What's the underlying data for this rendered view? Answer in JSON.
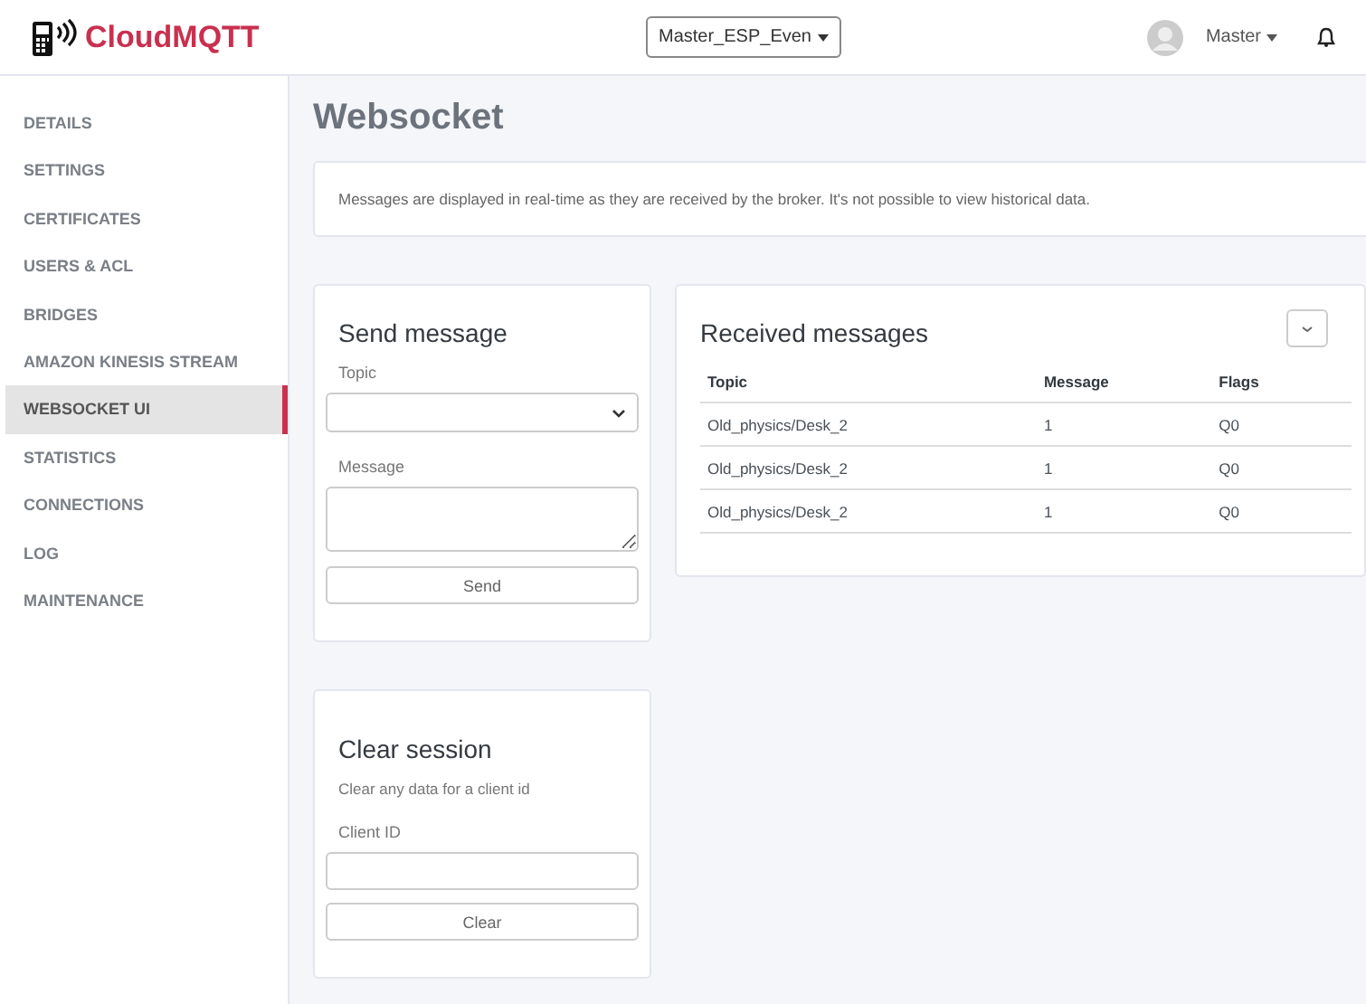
{
  "header": {
    "brand": "CloudMQTT",
    "instance": "Master_ESP_Even",
    "user": "Master"
  },
  "sidebar": {
    "items": [
      {
        "label": "DETAILS",
        "selected": false
      },
      {
        "label": "SETTINGS",
        "selected": false
      },
      {
        "label": "CERTIFICATES",
        "selected": false
      },
      {
        "label": "USERS & ACL",
        "selected": false
      },
      {
        "label": "BRIDGES",
        "selected": false
      },
      {
        "label": "AMAZON KINESIS STREAM",
        "selected": false
      },
      {
        "label": "WEBSOCKET UI",
        "selected": true
      },
      {
        "label": "STATISTICS",
        "selected": false
      },
      {
        "label": "CONNECTIONS",
        "selected": false
      },
      {
        "label": "LOG",
        "selected": false
      },
      {
        "label": "MAINTENANCE",
        "selected": false
      }
    ]
  },
  "page": {
    "title": "Websocket",
    "notice": "Messages are displayed in real-time as they are received by the broker. It's not possible to view historical data."
  },
  "send_message": {
    "title": "Send message",
    "topic_label": "Topic",
    "message_label": "Message",
    "button": "Send"
  },
  "received_messages": {
    "title": "Received messages",
    "columns": [
      "Topic",
      "Message",
      "Flags"
    ],
    "rows": [
      [
        "Old_physics/Desk_2",
        "1",
        "Q0"
      ],
      [
        "Old_physics/Desk_2",
        "1",
        "Q0"
      ],
      [
        "Old_physics/Desk_2",
        "1",
        "Q0"
      ]
    ]
  },
  "clear_session": {
    "title": "Clear session",
    "description": "Clear any data for a client id",
    "client_label": "Client ID",
    "button": "Clear"
  }
}
